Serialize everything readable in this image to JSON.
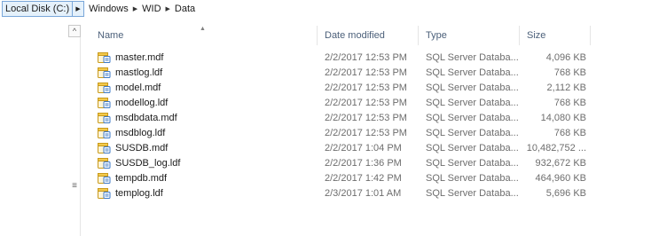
{
  "breadcrumb": {
    "root": "Local Disk (C:)",
    "path": [
      "Windows",
      "WID",
      "Data"
    ]
  },
  "columns": {
    "name": "Name",
    "date": "Date modified",
    "type": "Type",
    "size": "Size"
  },
  "icons": {
    "file": "database-file-icon",
    "scroll_up": "chevron-up-icon",
    "grip": "scroll-grip-icon",
    "sort": "sort-ascending-icon",
    "separator": "chevron-right-icon"
  },
  "colors": {
    "breadcrumb_highlight": "#e5f1fb",
    "header_text": "#4c607a",
    "icon_yellow": "#f2c94c",
    "icon_blue": "#3b78c7"
  },
  "files": [
    {
      "name": "master.mdf",
      "date": "2/2/2017 12:53 PM",
      "type": "SQL Server Databa...",
      "size": "4,096 KB"
    },
    {
      "name": "mastlog.ldf",
      "date": "2/2/2017 12:53 PM",
      "type": "SQL Server Databa...",
      "size": "768 KB"
    },
    {
      "name": "model.mdf",
      "date": "2/2/2017 12:53 PM",
      "type": "SQL Server Databa...",
      "size": "2,112 KB"
    },
    {
      "name": "modellog.ldf",
      "date": "2/2/2017 12:53 PM",
      "type": "SQL Server Databa...",
      "size": "768 KB"
    },
    {
      "name": "msdbdata.mdf",
      "date": "2/2/2017 12:53 PM",
      "type": "SQL Server Databa...",
      "size": "14,080 KB"
    },
    {
      "name": "msdblog.ldf",
      "date": "2/2/2017 12:53 PM",
      "type": "SQL Server Databa...",
      "size": "768 KB"
    },
    {
      "name": "SUSDB.mdf",
      "date": "2/2/2017 1:04 PM",
      "type": "SQL Server Databa...",
      "size": "10,482,752 ..."
    },
    {
      "name": "SUSDB_log.ldf",
      "date": "2/2/2017 1:36 PM",
      "type": "SQL Server Databa...",
      "size": "932,672 KB"
    },
    {
      "name": "tempdb.mdf",
      "date": "2/2/2017 1:42 PM",
      "type": "SQL Server Databa...",
      "size": "464,960 KB"
    },
    {
      "name": "templog.ldf",
      "date": "2/3/2017 1:01 AM",
      "type": "SQL Server Databa...",
      "size": "5,696 KB"
    }
  ]
}
